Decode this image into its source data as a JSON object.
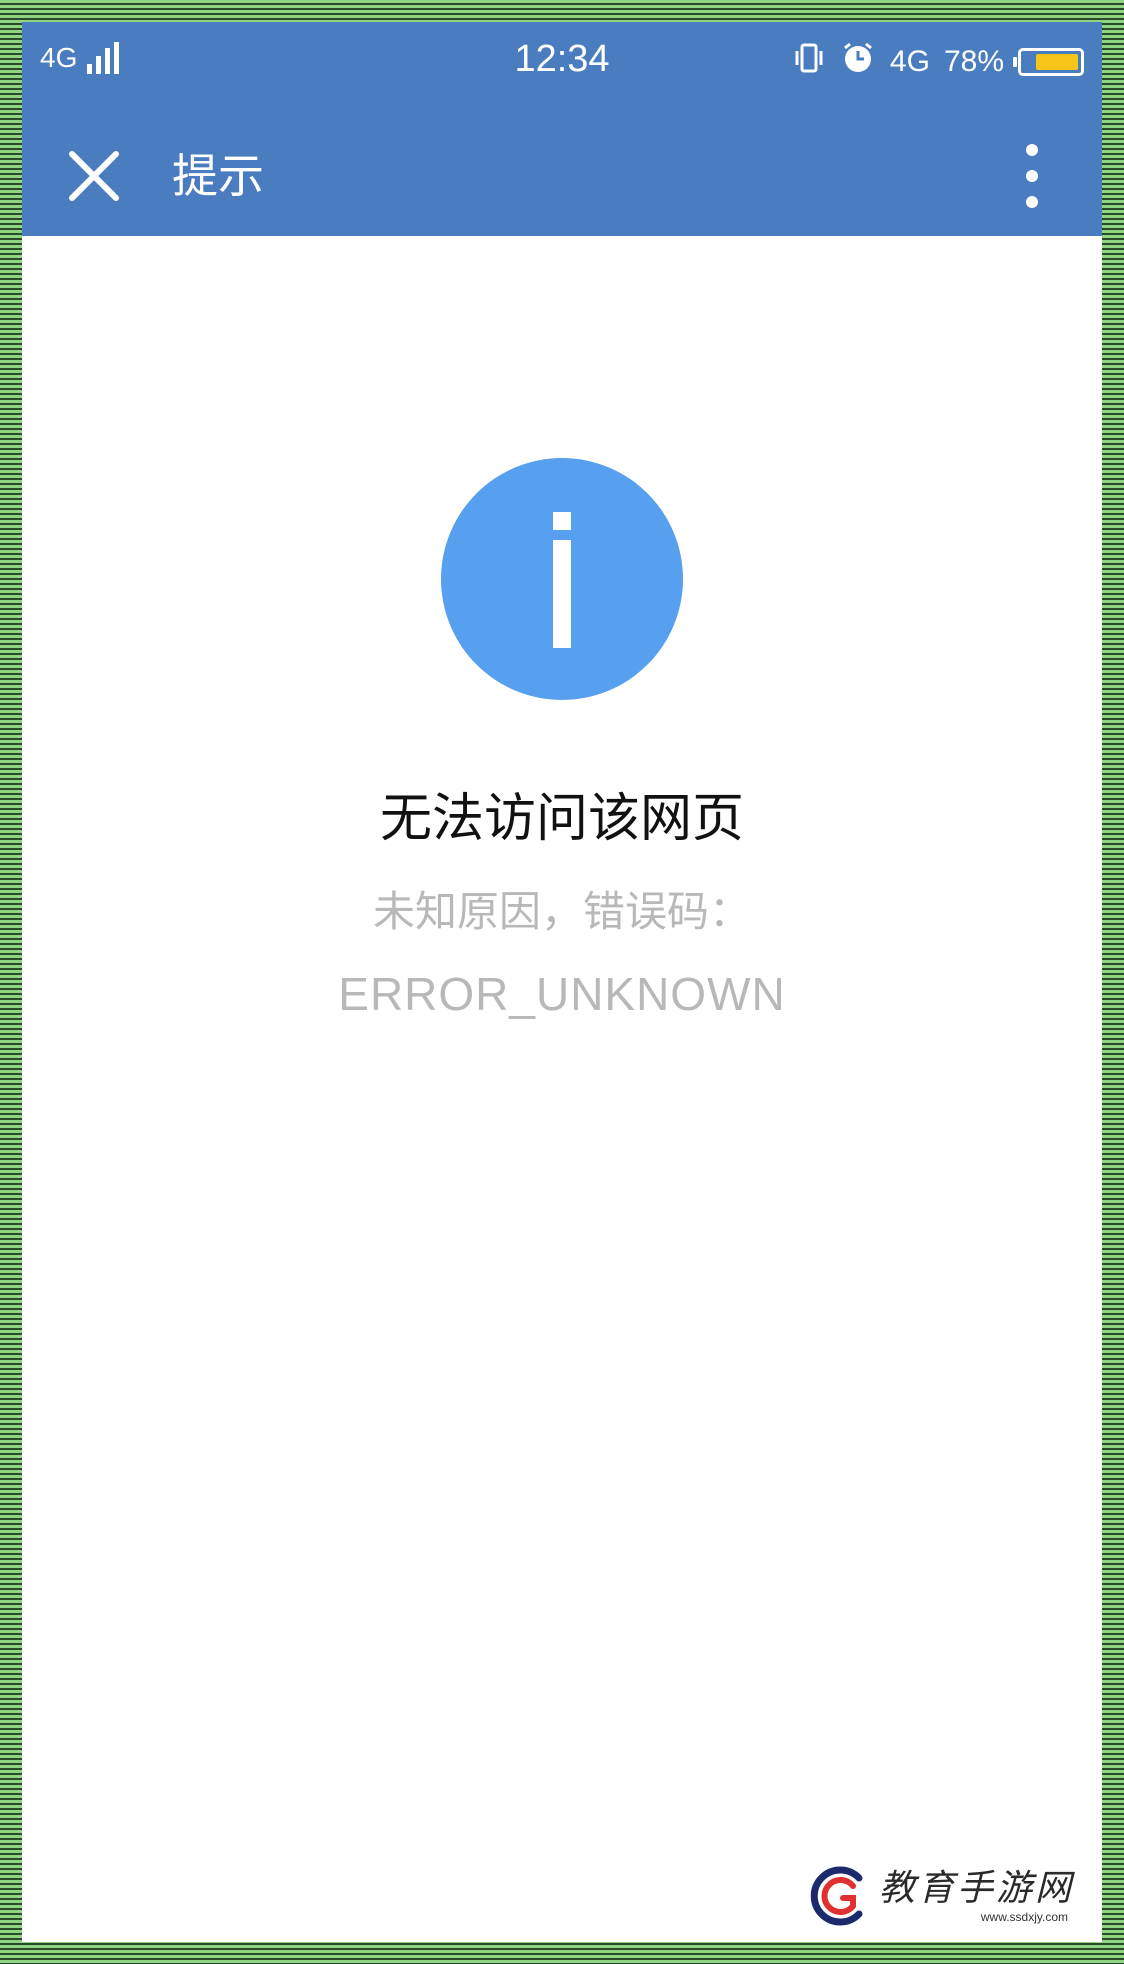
{
  "status_bar": {
    "network_left": "4G",
    "time": "12:34",
    "network_right": "4G",
    "battery": "78%",
    "battery_level": 0.78,
    "icons": [
      "signal-icon",
      "vibrate-icon",
      "alarm-icon",
      "battery-icon"
    ]
  },
  "title_bar": {
    "title": "提示",
    "close_icon": "close-icon",
    "more_icon": "more-vertical-icon"
  },
  "content": {
    "icon": "info-icon",
    "title": "无法访问该网页",
    "message": "未知原因，错误码：",
    "error_code": "ERROR_UNKNOWN"
  },
  "watermark": {
    "name": "教育手游网",
    "url": "www.ssdxjy.com"
  },
  "colors": {
    "header": "#4a7cc0",
    "info_icon": "#579fef",
    "battery_fill": "#f5c518",
    "secondary_text": "#b8b8b8"
  }
}
